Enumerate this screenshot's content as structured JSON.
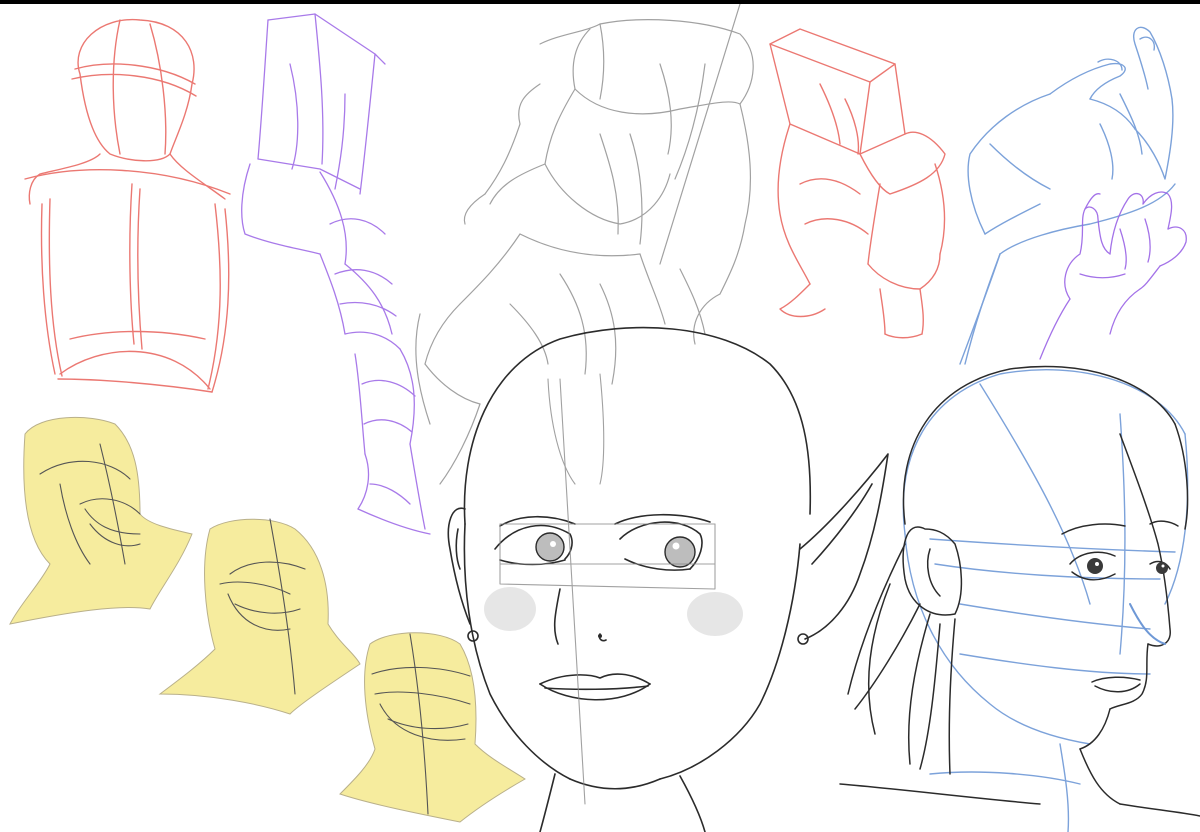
{
  "image": {
    "subject": "sketchbook-page-anatomy-studies",
    "background_color": "#ffffff",
    "border_color": "#000000",
    "colors": {
      "red_sketch": "#e8615a",
      "purple_sketch": "#9a63e6",
      "gray_sketch": "#8a8a8a",
      "blue_sketch": "#6e98d6",
      "pencil_dark": "#2b2b2b",
      "yellow_fill": "#f6ec9e",
      "blush": "#d9d9d9"
    },
    "elements": [
      "red-torso-sketch",
      "purple-arm-sketch",
      "gray-mannequin-sketch",
      "red-leg-block-sketch",
      "blue-hand-sketch",
      "purple-hand-sketch",
      "yellow-head-studies",
      "bald-elf-head-drawing",
      "woman-profile-drawing"
    ]
  }
}
